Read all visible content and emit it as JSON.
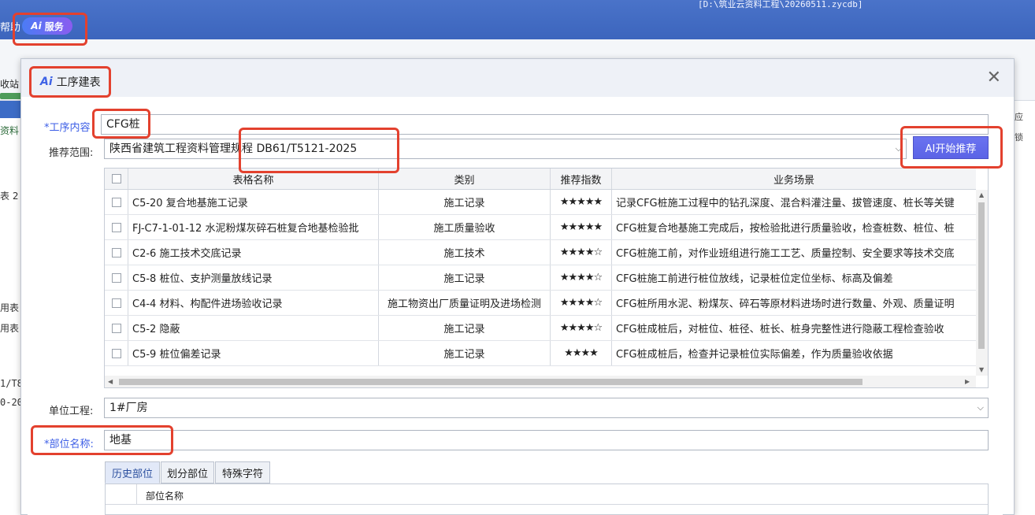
{
  "app": {
    "path": "[D:\\筑业云资料工程\\20260511.zycdb]",
    "help_menu": "帮助",
    "ai_service": "服务",
    "recycle_label": "收站",
    "left_fragments": [
      "资料",
      "表 2",
      "用表",
      "用表",
      "1/T8",
      "0-20"
    ],
    "right_fragments": [
      "应",
      "锁"
    ]
  },
  "dialog": {
    "title": "工序建表",
    "ai_mark": "Ai"
  },
  "form": {
    "process_label": "*工序内容",
    "process_value": "CFG桩",
    "scope_label": "推荐范围:",
    "scope_value": "陕西省建筑工程资料管理规程  DB61/T5121-2025",
    "ai_button": "AI开始推荐",
    "unit_label": "单位工程:",
    "unit_value": "1#厂房",
    "part_label": "*部位名称:",
    "part_value": "地基"
  },
  "table": {
    "headers": [
      "表格名称",
      "类别",
      "推荐指数",
      "业务场景"
    ],
    "rows": [
      {
        "name": "C5-20 复合地基施工记录",
        "category": "施工记录",
        "stars": "★★★★★",
        "scene": "记录CFG桩施工过程中的钻孔深度、混合料灌注量、拔管速度、桩长等关键"
      },
      {
        "name": "FJ-C7-1-01-12 水泥粉煤灰碎石桩复合地基检验批",
        "category": "施工质量验收",
        "stars": "★★★★★",
        "scene": "CFG桩复合地基施工完成后，按检验批进行质量验收，检查桩数、桩位、桩"
      },
      {
        "name": "C2-6 施工技术交底记录",
        "category": "施工技术",
        "stars": "★★★★☆",
        "scene": "CFG桩施工前，对作业班组进行施工工艺、质量控制、安全要求等技术交底"
      },
      {
        "name": "C5-8 桩位、支护测量放线记录",
        "category": "施工记录",
        "stars": "★★★★☆",
        "scene": "CFG桩施工前进行桩位放线，记录桩位定位坐标、标高及偏差"
      },
      {
        "name": "C4-4 材料、构配件进场验收记录",
        "category": "施工物资出厂质量证明及进场检测",
        "stars": "★★★★☆",
        "scene": "CFG桩所用水泥、粉煤灰、碎石等原材料进场时进行数量、外观、质量证明"
      },
      {
        "name": "C5-2 隐蔽",
        "category": "施工记录",
        "stars": "★★★★☆",
        "scene": "CFG桩成桩后，对桩位、桩径、桩长、桩身完整性进行隐蔽工程检查验收"
      },
      {
        "name": "C5-9 桩位偏差记录",
        "category": "施工记录",
        "stars": "★★★★",
        "scene": "CFG桩成桩后，检查并记录桩位实际偏差，作为质量验收依据"
      }
    ]
  },
  "tabs": [
    {
      "label": "历史部位"
    },
    {
      "label": "划分部位"
    },
    {
      "label": "特殊字符"
    }
  ],
  "sub_table": {
    "header": "部位名称"
  }
}
